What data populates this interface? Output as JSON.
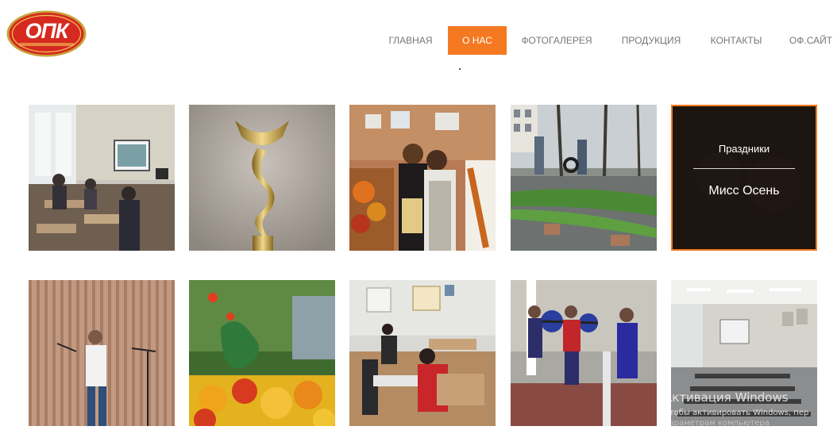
{
  "logo": {
    "text": "ОПК"
  },
  "nav": {
    "items": [
      {
        "label": "ГЛАВНАЯ",
        "active": false
      },
      {
        "label": "О НАС",
        "active": true
      },
      {
        "label": "ФОТОГАЛЕРЕЯ",
        "active": false
      },
      {
        "label": "ПРОДУКЦИЯ",
        "active": false
      },
      {
        "label": "КОНТАКТЫ",
        "active": false
      },
      {
        "label": "ОФ.САЙТ",
        "active": false
      }
    ],
    "accent_color": "#f47920"
  },
  "gallery": {
    "hover_overlay": {
      "category": "Праздники",
      "title": "Мисс Осень"
    },
    "photos": [
      "classroom-presentation-photo",
      "trophy-cup-photo",
      "two-girls-with-certificate-photo",
      "outdoor-cleanup-photo",
      "dark-event-photo",
      "singer-on-stage-photo",
      "flower-bed-photo",
      "computer-class-photo",
      "gym-weightlifting-photo",
      "empty-lecture-hall-photo"
    ]
  },
  "watermark": {
    "title": "Активация Windows",
    "line1": "Чтобы активировать Windows, пер",
    "line2": "параметрам компьютера"
  }
}
